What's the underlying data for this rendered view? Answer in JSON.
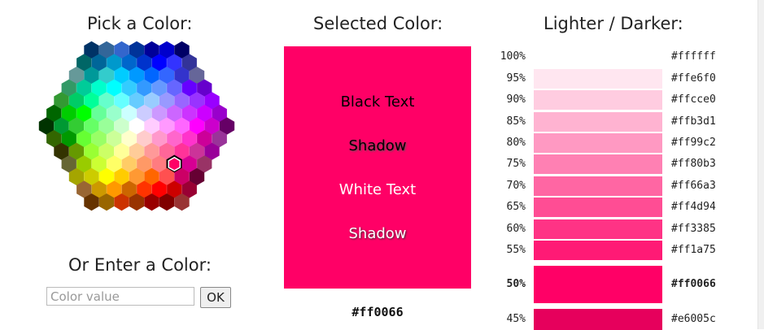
{
  "picker": {
    "title": "Pick a Color:",
    "rows": [
      [
        "#003366",
        "#336699",
        "#3366cc",
        "#003399",
        "#000099",
        "#0000cc",
        "#000066"
      ],
      [
        "#006666",
        "#006699",
        "#0099cc",
        "#0066cc",
        "#0033cc",
        "#0000ff",
        "#3333ff",
        "#333399"
      ],
      [
        "#669999",
        "#009999",
        "#33cccc",
        "#00ccff",
        "#0099ff",
        "#0066ff",
        "#3366ff",
        "#3333cc",
        "#666699"
      ],
      [
        "#339966",
        "#00cc99",
        "#00ffcc",
        "#00ffff",
        "#33ccff",
        "#3399ff",
        "#6699ff",
        "#6666ff",
        "#6600ff",
        "#6600cc"
      ],
      [
        "#339933",
        "#00cc66",
        "#00ff99",
        "#66ffcc",
        "#66ffff",
        "#66ccff",
        "#99ccff",
        "#9999ff",
        "#9966ff",
        "#9933ff",
        "#9900ff"
      ],
      [
        "#006600",
        "#00cc00",
        "#00ff00",
        "#66ff99",
        "#99ffcc",
        "#ccffff",
        "#ccccff",
        "#cc99ff",
        "#cc66ff",
        "#cc33ff",
        "#cc00ff",
        "#9900cc"
      ],
      [
        "#003300",
        "#009933",
        "#33cc33",
        "#66ff66",
        "#99ff99",
        "#ccffcc",
        "#ffffff",
        "#ffccff",
        "#ff99ff",
        "#ff66ff",
        "#ff00ff",
        "#cc00cc",
        "#660066"
      ],
      [
        "#336600",
        "#009900",
        "#66ff33",
        "#99ff66",
        "#ccff99",
        "#ffffcc",
        "#ffcccc",
        "#ff99cc",
        "#ff66cc",
        "#ff33cc",
        "#cc0099",
        "#993399"
      ],
      [
        "#333300",
        "#669900",
        "#99ff33",
        "#ccff66",
        "#ffff99",
        "#ffcc99",
        "#ff9999",
        "#ff6699",
        "#ff3399",
        "#cc3399",
        "#990099"
      ],
      [
        "#666633",
        "#99cc00",
        "#ccff33",
        "#ffff66",
        "#ffcc66",
        "#ff9966",
        "#ff7c80",
        "#ff0066",
        "#d60093",
        "#993366"
      ],
      [
        "#a5a500",
        "#cccc00",
        "#ffff00",
        "#ffcc00",
        "#ff9933",
        "#ff6600",
        "#ff5050",
        "#cc0066",
        "#660033"
      ],
      [
        "#996633",
        "#cc9900",
        "#ff9900",
        "#cc6600",
        "#ff3300",
        "#ff0000",
        "#cc0000",
        "#990033"
      ],
      [
        "#663300",
        "#996600",
        "#cc3300",
        "#993300",
        "#990000",
        "#800000",
        "#993333"
      ]
    ],
    "selected_row": 9,
    "selected_col": 7
  },
  "entry": {
    "title": "Or Enter a Color:",
    "placeholder": "Color value",
    "ok_label": "OK"
  },
  "selected": {
    "title": "Selected Color:",
    "color": "#ff0066",
    "black_text": "Black Text",
    "black_shadow": "Shadow",
    "white_text": "White Text",
    "white_shadow": "Shadow",
    "hex": "#ff0066"
  },
  "shades": {
    "title": "Lighter / Darker:",
    "items": [
      {
        "pct": "100%",
        "code": "#ffffff"
      },
      {
        "pct": "95%",
        "code": "#ffe6f0"
      },
      {
        "pct": "90%",
        "code": "#ffcce0"
      },
      {
        "pct": "85%",
        "code": "#ffb3d1"
      },
      {
        "pct": "80%",
        "code": "#ff99c2"
      },
      {
        "pct": "75%",
        "code": "#ff80b3"
      },
      {
        "pct": "70%",
        "code": "#ff66a3"
      },
      {
        "pct": "65%",
        "code": "#ff4d94"
      },
      {
        "pct": "60%",
        "code": "#ff3385"
      },
      {
        "pct": "55%",
        "code": "#ff1a75"
      },
      {
        "pct": "50%",
        "code": "#ff0066",
        "current": true
      },
      {
        "pct": "45%",
        "code": "#e6005c"
      }
    ]
  }
}
